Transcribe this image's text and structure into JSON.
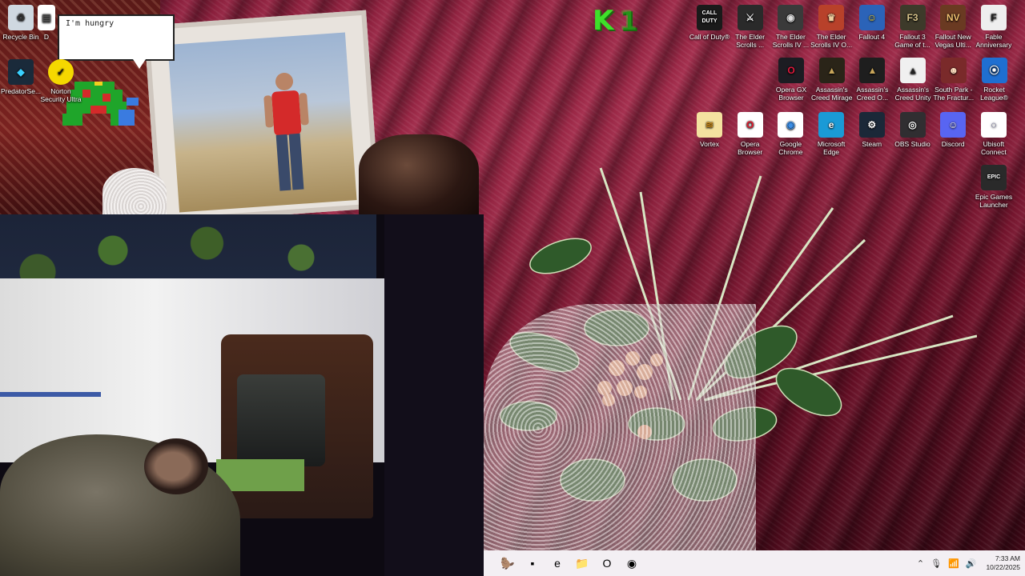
{
  "widget": {
    "bubble_text": "I'm hungry"
  },
  "desktop_left": [
    {
      "label": "Recycle Bin"
    },
    {
      "label": "D"
    },
    {
      "label": "PredatorSe..."
    },
    {
      "label": "Norton Security Ultra"
    }
  ],
  "desktop_icons_row1": [
    {
      "label": "Call of Duty®",
      "glyph": "CALL DUTY",
      "bg": "#1a1a1a",
      "fg": "#ffffff"
    },
    {
      "label": "The Elder Scrolls ...",
      "glyph": "⚔",
      "bg": "#2a2a2a",
      "fg": "#e8e8e8"
    },
    {
      "label": "The Elder Scrolls IV ...",
      "glyph": "◉",
      "bg": "#3a3a3a",
      "fg": "#dddddd"
    },
    {
      "label": "The Elder Scrolls IV O...",
      "glyph": "♛",
      "bg": "#b8412a",
      "fg": "#f0d0a0"
    },
    {
      "label": "Fallout 4",
      "glyph": "☺",
      "bg": "#2b63b8",
      "fg": "#f5d53a"
    },
    {
      "label": "Fallout 3 Game of t...",
      "glyph": "F3",
      "bg": "#3d3a2a",
      "fg": "#d8c48a"
    },
    {
      "label": "Fallout New Vegas Ulti...",
      "glyph": "NV",
      "bg": "#6a3a22",
      "fg": "#f0c070"
    },
    {
      "label": "Fable Anniversary",
      "glyph": "F",
      "bg": "#eeeeee",
      "fg": "#222222"
    }
  ],
  "desktop_icons_row2": [
    {
      "label": "Opera GX Browser",
      "glyph": "O",
      "bg": "#1c1c22",
      "fg": "#e0183c"
    },
    {
      "label": "Assassin's Creed Mirage",
      "glyph": "▲",
      "bg": "#2a2418",
      "fg": "#c9a65a"
    },
    {
      "label": "Assassin's Creed O...",
      "glyph": "▲",
      "bg": "#1e1e1e",
      "fg": "#c9a65a"
    },
    {
      "label": "Assassin's Creed Unity",
      "glyph": "▲",
      "bg": "#f0f0f0",
      "fg": "#222222"
    },
    {
      "label": "South Park - The Fractur...",
      "glyph": "☻",
      "bg": "#7a2a2a",
      "fg": "#ffe0c0"
    },
    {
      "label": "Rocket League®",
      "glyph": "⦿",
      "bg": "#1f6fd1",
      "fg": "#ffffff"
    }
  ],
  "desktop_icons_row3": [
    {
      "label": "Vortex",
      "glyph": "≋",
      "bg": "#f4e2a0",
      "fg": "#c98a1a"
    },
    {
      "label": "Opera Browser",
      "glyph": "O",
      "bg": "#ffffff",
      "fg": "#e0182c"
    },
    {
      "label": "Google Chrome",
      "glyph": "◉",
      "bg": "#ffffff",
      "fg": "#3a8ee6"
    },
    {
      "label": "Microsoft Edge",
      "glyph": "e",
      "bg": "#1a9ad6",
      "fg": "#ffffff"
    },
    {
      "label": "Steam",
      "glyph": "⚙",
      "bg": "#1b2838",
      "fg": "#ffffff"
    },
    {
      "label": "OBS Studio",
      "glyph": "◎",
      "bg": "#302e31",
      "fg": "#ffffff"
    },
    {
      "label": "Discord",
      "glyph": "☺",
      "bg": "#5865f2",
      "fg": "#ffffff"
    },
    {
      "label": "Ubisoft Connect",
      "glyph": "◌",
      "bg": "#ffffff",
      "fg": "#2a2a6a"
    }
  ],
  "desktop_icons_row4": [
    {
      "label": "Epic Games Launcher",
      "glyph": "EPIC",
      "bg": "#2a2a2a",
      "fg": "#ffffff"
    }
  ],
  "taskbar": {
    "apps": [
      {
        "name": "platypus-app",
        "glyph": "🦫"
      },
      {
        "name": "terminal-app",
        "glyph": "▪"
      },
      {
        "name": "edge-app",
        "glyph": "e"
      },
      {
        "name": "file-explorer-app",
        "glyph": "📁"
      },
      {
        "name": "opera-app",
        "glyph": "O"
      },
      {
        "name": "obs-app",
        "glyph": "◉"
      }
    ],
    "time": "7:33 AM",
    "date": "10/22/2025"
  }
}
